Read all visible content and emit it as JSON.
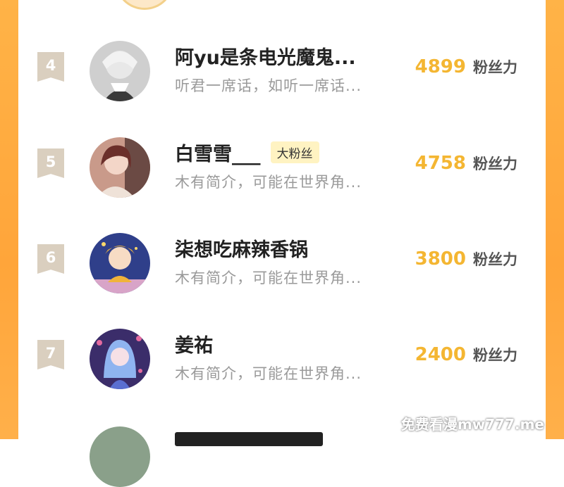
{
  "ranking": {
    "rows": [
      {
        "rank": "4",
        "name": "阿yu是条电光魔鬼...",
        "badge": "",
        "desc": "听君一席话，如听一席话...",
        "fans_count": "4899",
        "fans_label": "粉丝力"
      },
      {
        "rank": "5",
        "name": "白雪雪___",
        "badge": "大粉丝",
        "desc": "木有简介，可能在世界角...",
        "fans_count": "4758",
        "fans_label": "粉丝力"
      },
      {
        "rank": "6",
        "name": "柒想吃麻辣香锅",
        "badge": "",
        "desc": "木有简介，可能在世界角...",
        "fans_count": "3800",
        "fans_label": "粉丝力"
      },
      {
        "rank": "7",
        "name": "姜祐",
        "badge": "",
        "desc": "木有简介，可能在世界角...",
        "fans_count": "2400",
        "fans_label": "粉丝力"
      }
    ]
  },
  "watermark": "免费看漫mw777.me",
  "colors": {
    "side": "#ffa53a",
    "rank_badge": "#dacfbf",
    "fans_count": "#f4b632",
    "fan_badge_bg": "#fff3c2"
  }
}
